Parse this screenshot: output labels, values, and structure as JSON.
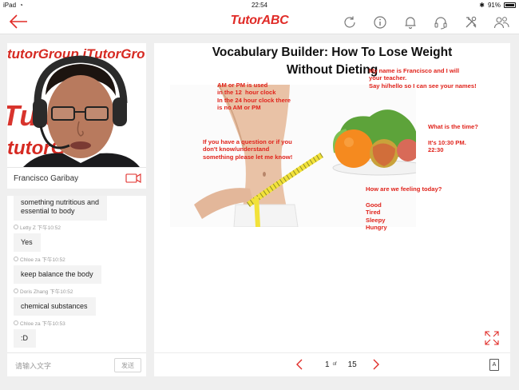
{
  "status_bar": {
    "device": "iPad",
    "time": "22:54",
    "battery": "91%"
  },
  "app": {
    "logo": "TutorABC"
  },
  "nav_icons": [
    "refresh-icon",
    "info-icon",
    "bell-icon",
    "headset-icon",
    "tools-icon",
    "users-icon"
  ],
  "video": {
    "banner_line1": "tutorGroup  iTutorGro",
    "banner_line2": "Tu   up",
    "banner_line3": "tutorGr",
    "teacher_name": "Francisco Garibay"
  },
  "chat": {
    "messages": [
      {
        "meta": "",
        "text": "something nutritious and\nessential to body"
      },
      {
        "meta": "Letty Z 下午10:52",
        "text": "Yes"
      },
      {
        "meta": "Chloe za 下午10:52",
        "text": "keep balance the body"
      },
      {
        "meta": "Doris Zhang 下午10:52",
        "text": "chemical substances"
      },
      {
        "meta": "Chloe za 下午10:53",
        "text": ":D"
      }
    ],
    "input_placeholder": "请输入文字",
    "send_label": "发送"
  },
  "slide": {
    "title_line1": "Vocabulary Builder: How To Lose Weight",
    "title_line2": "Without Dieting",
    "notes": {
      "am_pm": "AM or PM is used\nin the 12  hour clock\nIn the 24 hour clock there\nis no AM or PM",
      "intro": "My name is Francisco and I will\nyour teacher.\nSay hi/hello so I can see your names!",
      "question": "If you have a question or if you\ndon't know/understand\nsomething please let me know!",
      "time_q": "What is the time?",
      "time_a": "It's 10:30 PM.\n22:30",
      "feeling_q": "How are we feeling today?",
      "feeling_opts": "Good\nTired\nSleepy\nHungry"
    }
  },
  "pager": {
    "current": "1",
    "of": "of",
    "total": "15"
  },
  "colors": {
    "brand_red": "#e02b27",
    "note_red": "#e0231b"
  }
}
